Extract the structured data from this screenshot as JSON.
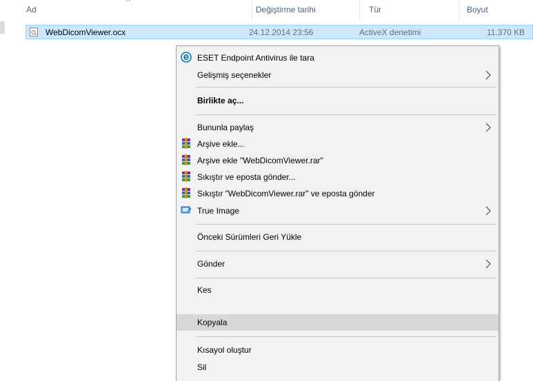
{
  "columns": {
    "name": "Ad",
    "modified": "Değiştirme tarihi",
    "type": "Tür",
    "size": "Boyut"
  },
  "file": {
    "name": "WebDicomViewer.ocx",
    "modified": "24.12.2014 23:56",
    "type": "ActiveX denetimi",
    "size": "11.370 KB"
  },
  "menu": {
    "eset": "ESET Endpoint Antivirus ile tara",
    "advanced": "Gelişmiş seçenekler",
    "open_with": "Birlikte aç...",
    "share_with": "Bununla paylaş",
    "add_to_archive": "Arşive ekle...",
    "add_to_rar": "Arşive ekle \"WebDicomViewer.rar\"",
    "compress_email": "Sıkıştır ve eposta gönder...",
    "compress_rar_email": "Sıkıştır \"WebDicomViewer.rar\" ve eposta gönder",
    "true_image": "True Image",
    "restore_previous": "Önceki Sürümleri Geri Yükle",
    "send_to": "Gönder",
    "cut": "Kes",
    "copy": "Kopyala",
    "create_shortcut": "Kısayol oluştur",
    "delete": "Sil"
  },
  "icons": {
    "eset": "eset-e-icon",
    "winrar": "winrar-books-icon",
    "true_image": "true-image-icon",
    "submenu": "chevron-right-icon",
    "file": "file-icon",
    "sort": "sort-arrow-icon"
  },
  "colors": {
    "selection_bg": "#cce8ff",
    "selection_border": "#99d1ff",
    "menu_bg": "#f2f2f2",
    "menu_highlight": "#d8d8d8",
    "header_text": "#4c607a",
    "eset_blue": "#0074b8"
  }
}
